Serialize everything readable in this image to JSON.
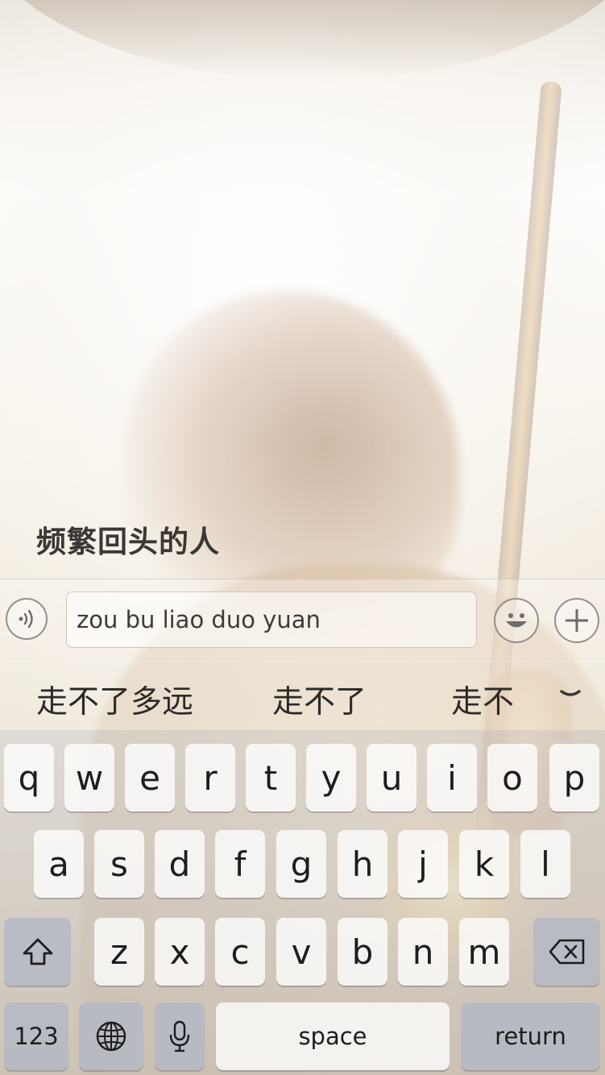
{
  "chat": {
    "title": "频繁回头的人"
  },
  "input_bar": {
    "text_value": "zou bu liao duo yuan",
    "voice_icon": "voice-wave-icon",
    "emoji_icon": "smiley-icon",
    "plus_icon": "plus-icon"
  },
  "candidates": {
    "items": [
      "走不了多远",
      "走不了",
      "走不"
    ],
    "expand_icon": "chevron-down-icon"
  },
  "keyboard": {
    "row1": [
      "q",
      "w",
      "e",
      "r",
      "t",
      "y",
      "u",
      "i",
      "o",
      "p"
    ],
    "row2": [
      "a",
      "s",
      "d",
      "f",
      "g",
      "h",
      "j",
      "k",
      "l"
    ],
    "row3": [
      "z",
      "x",
      "c",
      "v",
      "b",
      "n",
      "m"
    ],
    "shift_icon": "shift-arrow-icon",
    "delete_icon": "backspace-icon",
    "numbers_label": "123",
    "globe_icon": "globe-icon",
    "mic_icon": "microphone-icon",
    "space_label": "space",
    "return_label": "return"
  },
  "colors": {
    "key_background": "#ffffff",
    "function_key_background": "#b2b8c4",
    "text_primary": "#1d1d1f",
    "title_text": "#3a3734"
  }
}
